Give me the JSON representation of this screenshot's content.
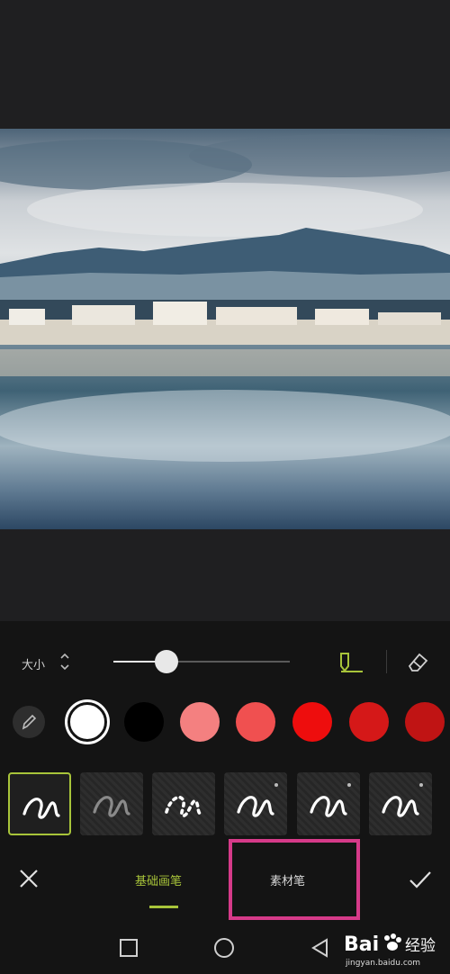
{
  "toolbar": {
    "size_label": "大小",
    "size_value": 0.3
  },
  "colors": [
    "#ffffff",
    "#000000",
    "#f48080",
    "#f05050",
    "#ee0d0d",
    "#d51818",
    "#c01414"
  ],
  "brushes": [
    {
      "variant": "solid-white",
      "selected": true
    },
    {
      "variant": "faded-gray",
      "selected": false
    },
    {
      "variant": "dotted",
      "selected": false
    },
    {
      "variant": "solid-white",
      "selected": false
    },
    {
      "variant": "solid-white",
      "selected": false
    },
    {
      "variant": "solid-white",
      "selected": false
    }
  ],
  "tabs": {
    "basic": "基础画笔",
    "material": "素材笔"
  },
  "icons": {
    "close": "close-icon",
    "confirm": "checkmark-icon",
    "pen": "pen-icon",
    "eraser": "eraser-icon"
  },
  "watermark": {
    "brand": "Bai",
    "brand_cn": "经验",
    "url": "jingyan.baidu.com"
  },
  "accent_color": "#a8c43a",
  "highlight_color": "#d63a89"
}
